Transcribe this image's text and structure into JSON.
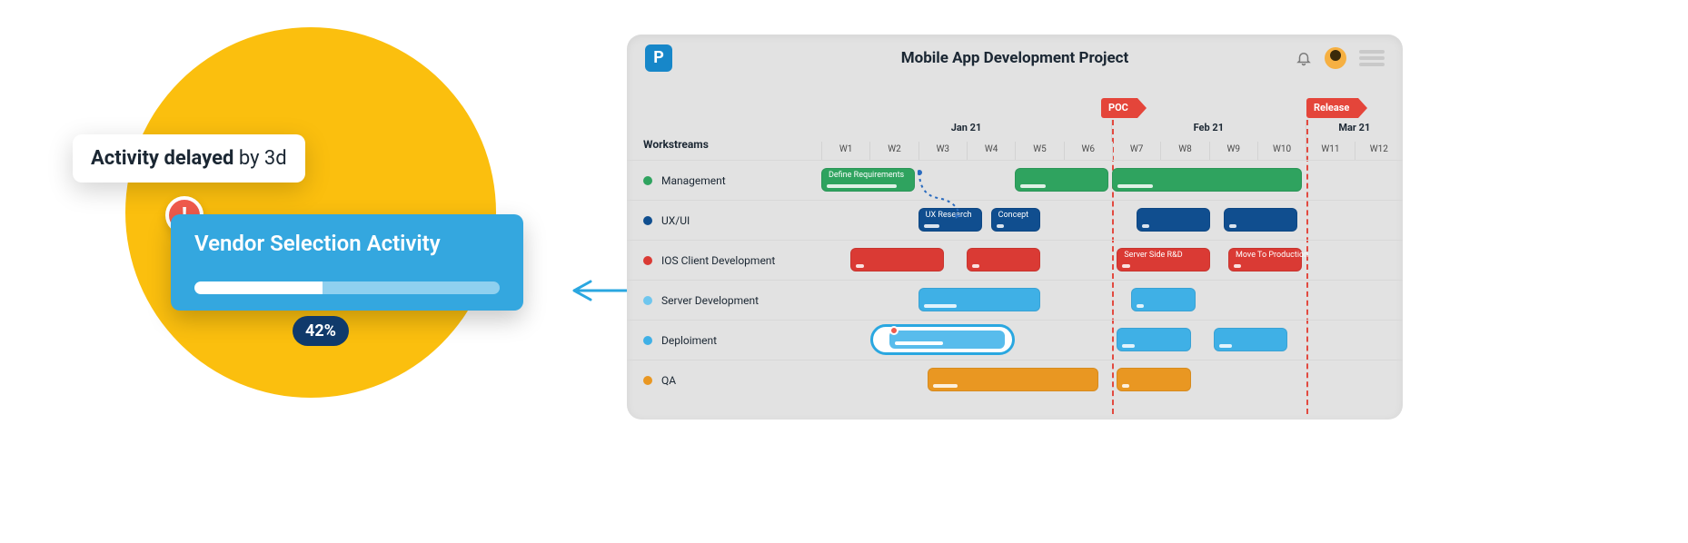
{
  "zoom": {
    "tooltip_strong": "Activity delayed",
    "tooltip_rest": " by 3d",
    "title": "Vendor Selection Activity",
    "percent_label": "42%",
    "progress_pct": 42,
    "alert_icon": "alert-icon"
  },
  "app": {
    "title": "Mobile App Development Project",
    "logo_letter": "P",
    "sidebar_heading": "Workstreams",
    "milestones": [
      {
        "label": "POC",
        "week_index": 6
      },
      {
        "label": "Release",
        "week_index": 10
      }
    ],
    "months": [
      {
        "label": "Jan 21",
        "weeks": 6
      },
      {
        "label": "Feb 21",
        "weeks": 4
      },
      {
        "label": "Mar 21",
        "weeks": 2
      }
    ],
    "week_labels": [
      "W1",
      "W2",
      "W3",
      "W4",
      "W5",
      "W6",
      "W7",
      "W8",
      "W9",
      "W10",
      "W11",
      "W12"
    ],
    "rows": [
      {
        "name": "Management",
        "color": "#2fa35f",
        "bars": [
          {
            "label": "Define Requirements",
            "start": 0,
            "span": 2,
            "color": "g",
            "progress": 85
          },
          {
            "label": "",
            "start": 4,
            "span": 2,
            "color": "g",
            "progress": 30
          },
          {
            "label": "",
            "start": 6,
            "span": 4,
            "color": "g",
            "progress": 20
          }
        ]
      },
      {
        "name": "UX/UI",
        "color": "#104e8f",
        "bars": [
          {
            "label": "UX Research",
            "start": 2,
            "span": 1.4,
            "color": "b-d",
            "progress": 30
          },
          {
            "label": "Concept",
            "start": 3.5,
            "span": 1.1,
            "color": "b-d",
            "progress": 0
          },
          {
            "label": "",
            "start": 6.5,
            "span": 1.6,
            "color": "b-d",
            "progress": 0
          },
          {
            "label": "",
            "start": 8.3,
            "span": 1.6,
            "color": "b-d",
            "progress": 0
          }
        ]
      },
      {
        "name": "IOS Client Development",
        "color": "#da3a34",
        "bars": [
          {
            "label": "",
            "start": 0.6,
            "span": 2,
            "color": "r",
            "progress": 10
          },
          {
            "label": "",
            "start": 3,
            "span": 1.6,
            "color": "r",
            "progress": 10
          },
          {
            "label": "Server Side R&D",
            "start": 6.1,
            "span": 2,
            "color": "r",
            "progress": 10
          },
          {
            "label": "Move To Production",
            "start": 8.4,
            "span": 1.6,
            "color": "r",
            "progress": 10
          }
        ]
      },
      {
        "name": "Server Development",
        "color": "#6fc6ee",
        "bars": [
          {
            "label": "",
            "start": 2,
            "span": 2.6,
            "color": "b-l",
            "progress": 30
          },
          {
            "label": "",
            "start": 6.4,
            "span": 1.4,
            "color": "b-l",
            "progress": 10
          }
        ]
      },
      {
        "name": "Deploiment",
        "color": "#3fb0e6",
        "highlight": {
          "start": 1.2,
          "span": 2.6,
          "progress": 42
        },
        "bars": [
          {
            "label": "",
            "start": 6.1,
            "span": 1.6,
            "color": "b-l",
            "progress": 20
          },
          {
            "label": "",
            "start": 8.1,
            "span": 1.6,
            "color": "b-l",
            "progress": 20
          }
        ]
      },
      {
        "name": "QA",
        "color": "#e99722",
        "bars": [
          {
            "label": "",
            "start": 2.2,
            "span": 3.6,
            "color": "o",
            "progress": 15
          },
          {
            "label": "",
            "start": 6.1,
            "span": 1.6,
            "color": "o",
            "progress": 10
          }
        ]
      }
    ],
    "dependency": {
      "from_row": 0,
      "from_end_week": 2,
      "to_row": 1,
      "to_start_week": 2
    }
  },
  "colors": {
    "accent_yellow": "#fbbf0e",
    "accent_blue": "#34a7df",
    "alert_red": "#ef5b4c",
    "milestone_red": "#e4453a"
  }
}
